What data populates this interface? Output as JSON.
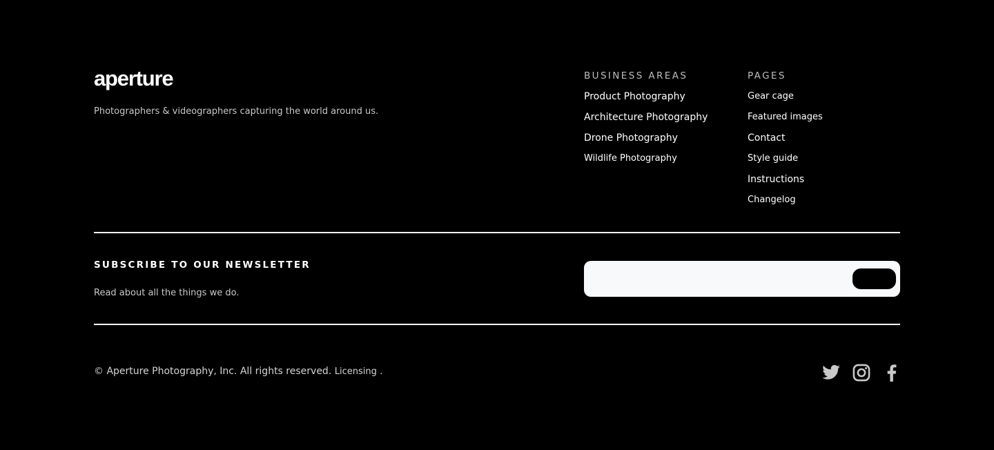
{
  "brand": {
    "logo_text": "aperture",
    "tagline": "Photographers & videographers capturing the world around us."
  },
  "business_areas": {
    "heading": "BUSINESS AREAS",
    "links": [
      "Product Photography",
      "Architecture Photography",
      "Drone Photography",
      "Wildlife Photography"
    ]
  },
  "pages": {
    "heading": "PAGES",
    "links": [
      "Gear cage",
      "Featured images",
      "Contact",
      "Style guide",
      "Instructions",
      "Changelog"
    ]
  },
  "newsletter": {
    "title": "SUBSCRIBE TO OUR NEWSLETTER",
    "subtitle": "Read about all the things we do.",
    "input_placeholder": "",
    "button_label": ""
  },
  "legal": {
    "copyright": "© Aperture Photography, Inc. All rights reserved.",
    "licensing": "Licensing",
    "period": "."
  },
  "social": {
    "icons": [
      "twitter-icon",
      "instagram-icon",
      "facebook-icon"
    ],
    "icon_color": "#c9c9c9"
  },
  "colors": {
    "background": "#000000",
    "text": "#ffffff",
    "muted": "#bdbdbd",
    "input_bg": "#f7f9fb"
  }
}
